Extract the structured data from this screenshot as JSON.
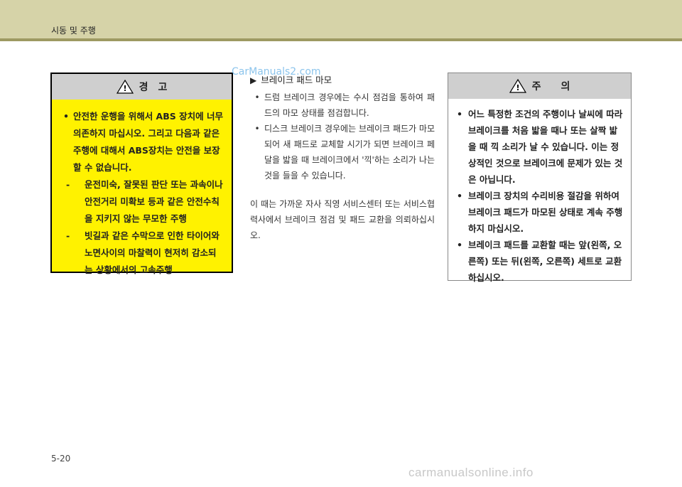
{
  "header": {
    "title": "시동 및 주행"
  },
  "warning": {
    "heading": "경　고",
    "bullet": "•",
    "main": "안전한 운행을 위해서 ABS 장치에 너무 의존하지 마십시오. 그리고 다음과 같은 주행에 대해서 ABS장치는 안전을 보장할 수 없습니다.",
    "dash": "-",
    "sub1": "운전미숙, 잘못된 판단 또는 과속이나 안전거리 미확보 등과 같은 안전수칙을 지키지 않는 무모한 주행",
    "sub2": "빗길과 같은 수막으로 인한 타이어와 노면사이의 마찰력이 현저히 감소되는 상황에서의 고속주행"
  },
  "brake": {
    "arrow": "▶",
    "title": "브레이크 패드 마모",
    "bullet": "•",
    "items": [
      "드럼 브레이크 경우에는 수시 점검을 통하여 패드의 마모 상태를 점검합니다.",
      "디스크 브레이크 경우에는 브레이크 패드가 마모되어 새 패드로 교체할 시기가 되면 브레이크 페달을 밟을 때 브레이크에서 '끽'하는 소리가 나는 것을 들을 수 있습니다."
    ],
    "note": "이 때는 가까운 자사 직영 서비스센터 또는 서비스협력사에서 브레이크 점검 및 패드 교환을 의뢰하십시오."
  },
  "caution": {
    "heading": "주　　의",
    "bullet": "•",
    "items": [
      "어느 특정한 조건의 주행이나 날씨에 따라 브레이크를 처음 밟을 때나 또는 살짝 밟을 때 끽 소리가 날 수 있습니다. 이는 정상적인 것으로 브레이크에 문제가 있는 것은 아닙니다.",
      "브레이크 장치의 수리비용 절감을 위하여 브레이크 패드가 마모된 상태로 계속 주행하지 마십시오.",
      "브레이크 패드를 교환할 때는 앞(왼쪽, 오른쪽) 또는 뒤(왼쪽, 오른쪽) 세트로 교환하십시오."
    ]
  },
  "footer": {
    "page": "5-20"
  },
  "watermarks": {
    "top": "CarManuals2.com",
    "bottom": "carmanualsonline.info"
  },
  "colors": {
    "header_bg": "#d6d3a8",
    "header_rule": "#9e9a62",
    "warning_bg": "#fff200",
    "box_head_bg": "#cfcfcf"
  }
}
